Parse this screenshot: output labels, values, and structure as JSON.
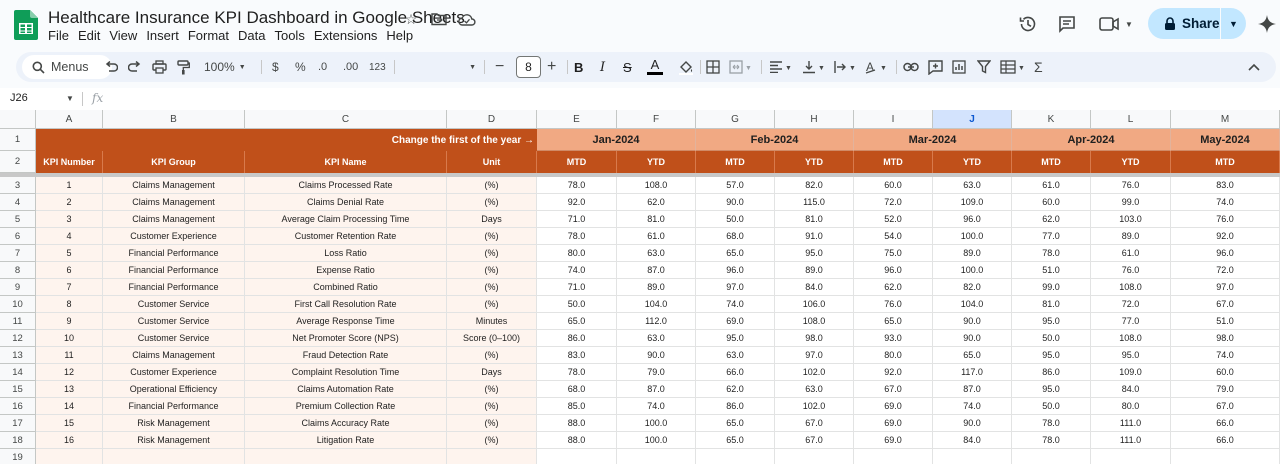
{
  "app": {
    "title": "Healthcare Insurance KPI Dashboard in Google Sheets",
    "menu": [
      "File",
      "Edit",
      "View",
      "Insert",
      "Format",
      "Data",
      "Tools",
      "Extensions",
      "Help"
    ],
    "share_label": "Share"
  },
  "toolbar": {
    "menus_label": "Menus",
    "zoom": "100%",
    "currency": "$",
    "percent": "%",
    "dec_decrease": ".0",
    "dec_increase": ".00",
    "number_format": "123",
    "font_size": "8"
  },
  "formula_bar": {
    "name_box": "J26",
    "fx": "fx",
    "formula": ""
  },
  "columns": [
    "A",
    "B",
    "C",
    "D",
    "E",
    "F",
    "G",
    "H",
    "I",
    "J",
    "K",
    "L",
    "M"
  ],
  "selected_column": "J",
  "rows": [
    "1",
    "2",
    "3",
    "4",
    "5",
    "6",
    "7",
    "8",
    "9",
    "10",
    "11",
    "12",
    "13",
    "14",
    "15",
    "16",
    "17",
    "18",
    "19"
  ],
  "sheet": {
    "banner": "Change the first of the year →",
    "months": [
      "Jan-2024",
      "Feb-2024",
      "Mar-2024",
      "Apr-2024",
      "May-2024"
    ],
    "headers": [
      "KPI Number",
      "KPI Group",
      "KPI Name",
      "Unit"
    ],
    "sub_headers": [
      "MTD",
      "YTD",
      "MTD",
      "YTD",
      "MTD",
      "YTD",
      "MTD",
      "YTD",
      "MTD"
    ],
    "kpis": [
      {
        "num": "1",
        "group": "Claims Management",
        "name": "Claims Processed Rate",
        "unit": "(%)",
        "values": [
          "78.0",
          "108.0",
          "57.0",
          "82.0",
          "60.0",
          "63.0",
          "61.0",
          "76.0",
          "83.0"
        ]
      },
      {
        "num": "2",
        "group": "Claims Management",
        "name": "Claims Denial Rate",
        "unit": "(%)",
        "values": [
          "92.0",
          "62.0",
          "90.0",
          "115.0",
          "72.0",
          "109.0",
          "60.0",
          "99.0",
          "74.0"
        ]
      },
      {
        "num": "3",
        "group": "Claims Management",
        "name": "Average Claim Processing Time",
        "unit": "Days",
        "values": [
          "71.0",
          "81.0",
          "50.0",
          "81.0",
          "52.0",
          "96.0",
          "62.0",
          "103.0",
          "76.0"
        ]
      },
      {
        "num": "4",
        "group": "Customer Experience",
        "name": "Customer Retention Rate",
        "unit": "(%)",
        "values": [
          "78.0",
          "61.0",
          "68.0",
          "91.0",
          "54.0",
          "100.0",
          "77.0",
          "89.0",
          "92.0"
        ]
      },
      {
        "num": "5",
        "group": "Financial Performance",
        "name": "Loss Ratio",
        "unit": "(%)",
        "values": [
          "80.0",
          "63.0",
          "65.0",
          "95.0",
          "75.0",
          "89.0",
          "78.0",
          "61.0",
          "96.0"
        ]
      },
      {
        "num": "6",
        "group": "Financial Performance",
        "name": "Expense Ratio",
        "unit": "(%)",
        "values": [
          "74.0",
          "87.0",
          "96.0",
          "89.0",
          "96.0",
          "100.0",
          "51.0",
          "76.0",
          "72.0"
        ]
      },
      {
        "num": "7",
        "group": "Financial Performance",
        "name": "Combined Ratio",
        "unit": "(%)",
        "values": [
          "71.0",
          "89.0",
          "97.0",
          "84.0",
          "62.0",
          "82.0",
          "99.0",
          "108.0",
          "97.0"
        ]
      },
      {
        "num": "8",
        "group": "Customer Service",
        "name": "First Call Resolution Rate",
        "unit": "(%)",
        "values": [
          "50.0",
          "104.0",
          "74.0",
          "106.0",
          "76.0",
          "104.0",
          "81.0",
          "72.0",
          "67.0"
        ]
      },
      {
        "num": "9",
        "group": "Customer Service",
        "name": "Average Response Time",
        "unit": "Minutes",
        "values": [
          "65.0",
          "112.0",
          "69.0",
          "108.0",
          "65.0",
          "90.0",
          "95.0",
          "77.0",
          "51.0"
        ]
      },
      {
        "num": "10",
        "group": "Customer Service",
        "name": "Net Promoter Score (NPS)",
        "unit": "Score (0–100)",
        "values": [
          "86.0",
          "63.0",
          "95.0",
          "98.0",
          "93.0",
          "90.0",
          "50.0",
          "108.0",
          "98.0"
        ]
      },
      {
        "num": "11",
        "group": "Claims Management",
        "name": "Fraud Detection Rate",
        "unit": "(%)",
        "values": [
          "83.0",
          "90.0",
          "63.0",
          "97.0",
          "80.0",
          "65.0",
          "95.0",
          "95.0",
          "74.0"
        ]
      },
      {
        "num": "12",
        "group": "Customer Experience",
        "name": "Complaint Resolution Time",
        "unit": "Days",
        "values": [
          "78.0",
          "79.0",
          "66.0",
          "102.0",
          "92.0",
          "117.0",
          "86.0",
          "109.0",
          "60.0"
        ]
      },
      {
        "num": "13",
        "group": "Operational Efficiency",
        "name": "Claims Automation Rate",
        "unit": "(%)",
        "values": [
          "68.0",
          "87.0",
          "62.0",
          "63.0",
          "67.0",
          "87.0",
          "95.0",
          "84.0",
          "79.0"
        ]
      },
      {
        "num": "14",
        "group": "Financial Performance",
        "name": "Premium Collection Rate",
        "unit": "(%)",
        "values": [
          "85.0",
          "74.0",
          "86.0",
          "102.0",
          "69.0",
          "74.0",
          "50.0",
          "80.0",
          "67.0"
        ]
      },
      {
        "num": "15",
        "group": "Risk Management",
        "name": "Claims Accuracy Rate",
        "unit": "(%)",
        "values": [
          "88.0",
          "100.0",
          "65.0",
          "67.0",
          "69.0",
          "90.0",
          "78.0",
          "111.0",
          "66.0"
        ]
      },
      {
        "num": "16",
        "group": "Risk Management",
        "name": "Litigation Rate",
        "unit": "(%)",
        "values": [
          "88.0",
          "100.0",
          "65.0",
          "67.0",
          "69.0",
          "84.0",
          "78.0",
          "111.0",
          "66.0"
        ]
      }
    ]
  },
  "colors": {
    "header_dark": "#c0501a",
    "header_light": "#f1a983",
    "left_fill": "#fef4ee",
    "share_bg": "#c2e7ff"
  }
}
